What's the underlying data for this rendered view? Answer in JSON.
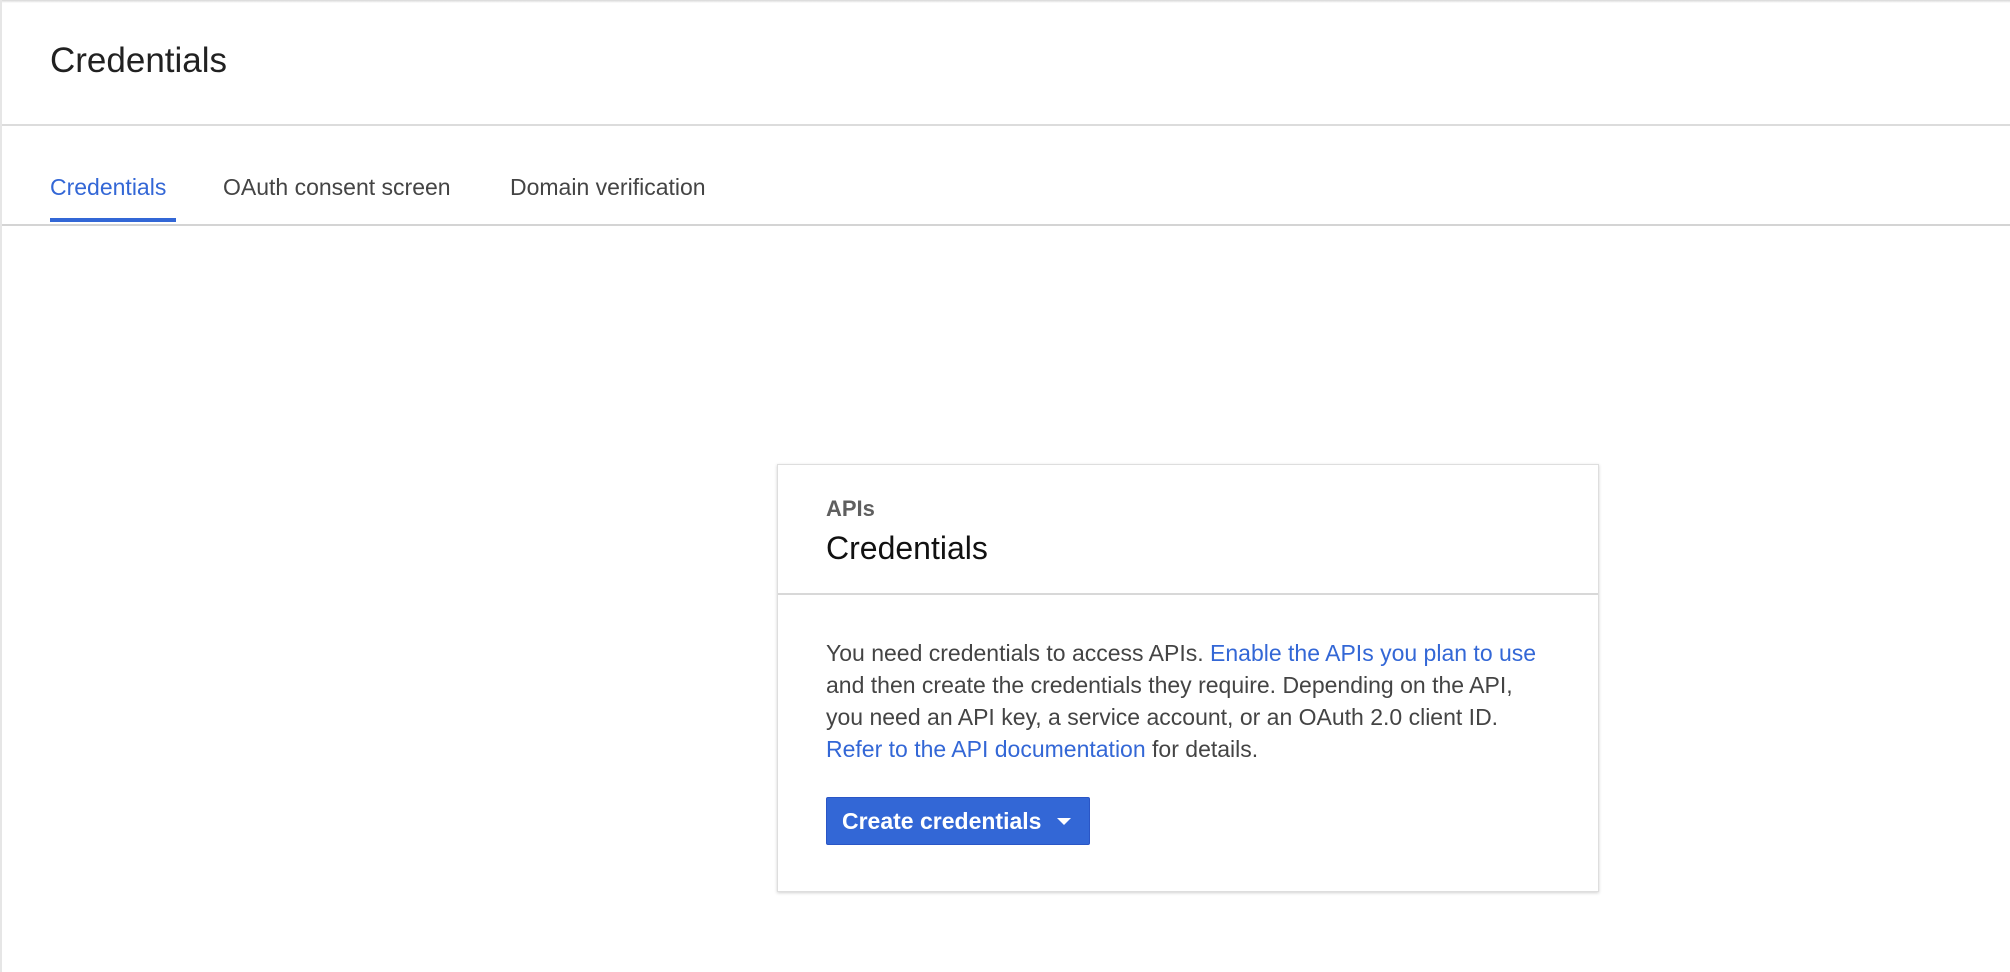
{
  "header": {
    "title": "Credentials"
  },
  "tabs": [
    {
      "label": "Credentials",
      "active": true
    },
    {
      "label": "OAuth consent screen",
      "active": false
    },
    {
      "label": "Domain verification",
      "active": false
    }
  ],
  "card": {
    "overline": "APIs",
    "title": "Credentials",
    "body": {
      "text_1": "You need credentials to access APIs. ",
      "link_1": "Enable the APIs you plan to use",
      "text_2": " and then create the credentials they require. Depending on the API, you need an API key, a service account, or an OAuth 2.0 client ID. ",
      "link_2": "Refer to the API documentation",
      "text_3": " for details."
    },
    "button": {
      "label": "Create credentials",
      "icon": "caret-down-icon"
    }
  },
  "colors": {
    "accent": "#3367d6",
    "text_primary": "#212121",
    "text_secondary": "#444444",
    "divider": "#dcdcdc"
  }
}
